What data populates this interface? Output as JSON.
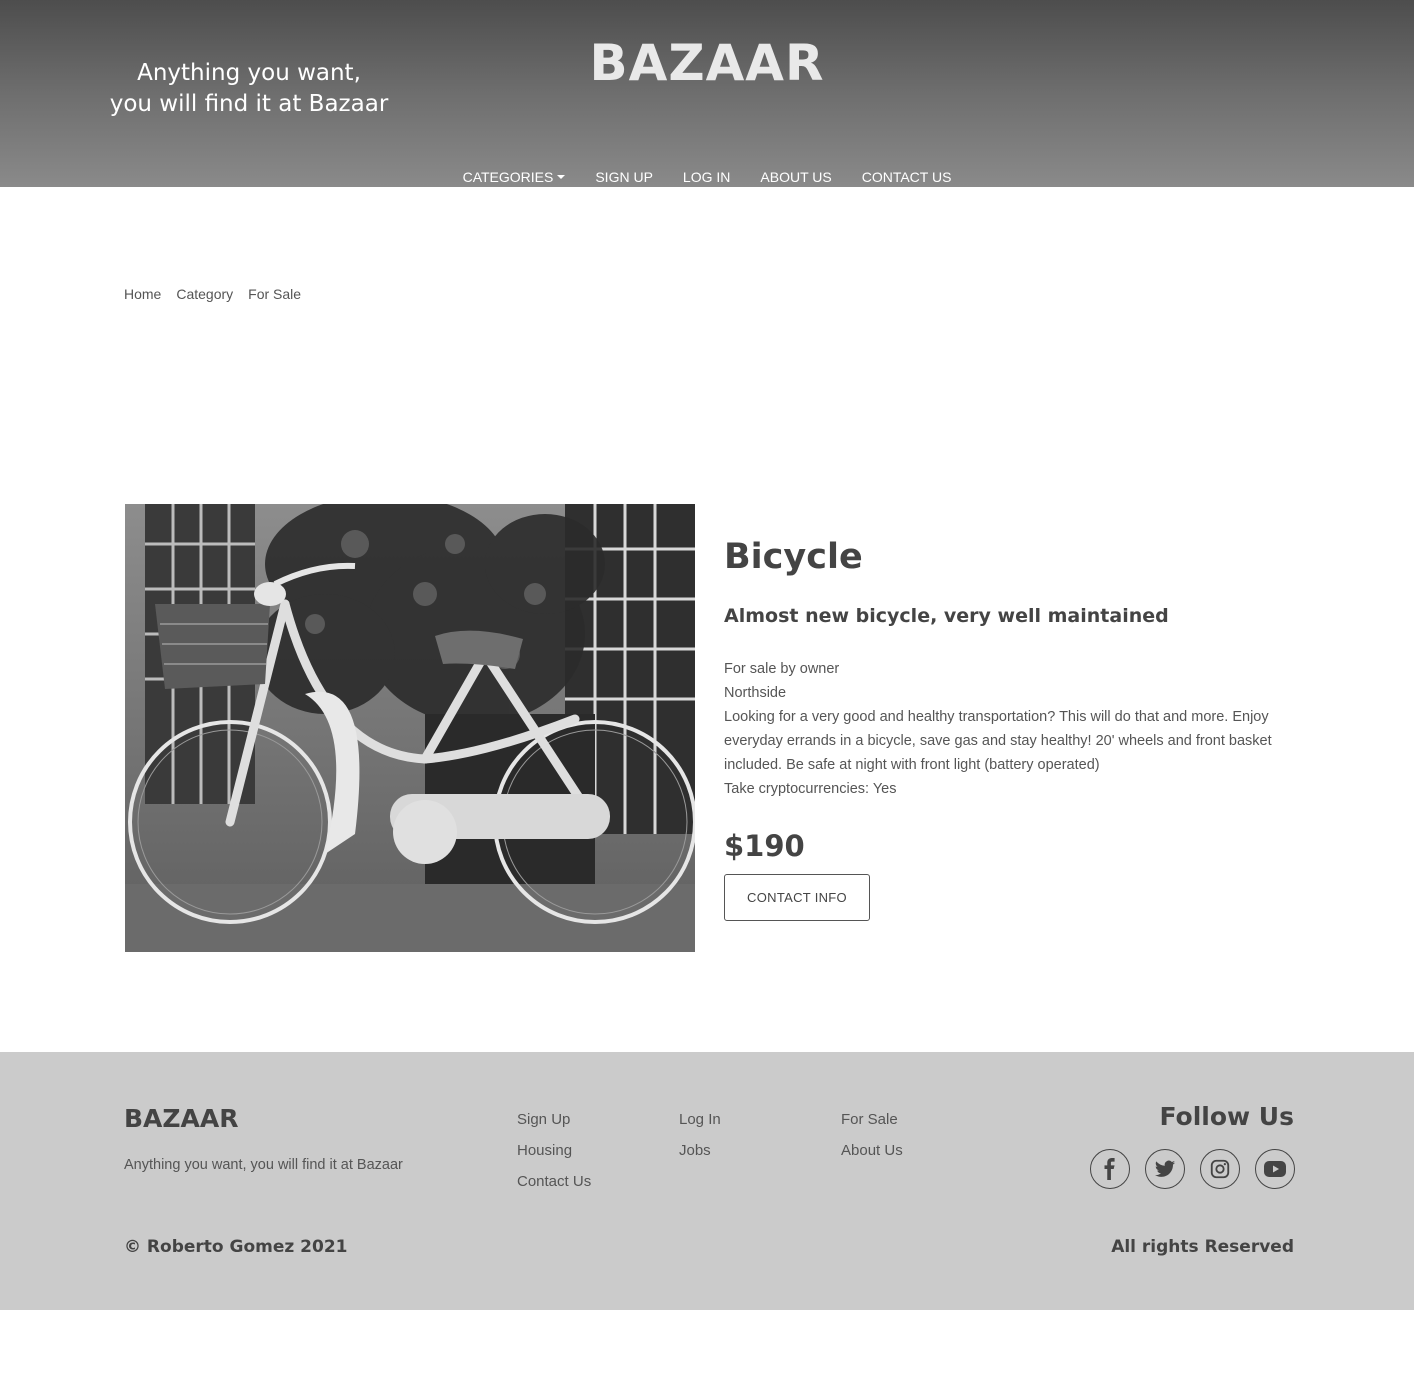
{
  "header": {
    "tagline_line1": "Anything you want,",
    "tagline_line2": "you will find it at Bazaar",
    "brand": "BAZAAR",
    "nav": {
      "categories": "CATEGORIES",
      "signup": "SIGN UP",
      "login": "LOG IN",
      "about": "ABOUT US",
      "contact": "CONTACT US"
    }
  },
  "breadcrumb": {
    "home": "Home",
    "category": "Category",
    "for_sale": "For Sale"
  },
  "product": {
    "title": "Bicycle",
    "subtitle": "Almost new bicycle, very well maintained",
    "seller": "For sale by owner",
    "location": "Northside",
    "description": "Looking for a very good and healthy transportation? This will do that and more. Enjoy everyday errands in a bicycle, save gas and stay healthy! 20' wheels and front basket included. Be safe at night with front light (battery operated)",
    "crypto": "Take cryptocurrencies: Yes",
    "price": "$190",
    "contact_button": "CONTACT INFO",
    "image_icon": "bicycle-photo"
  },
  "footer": {
    "brand": "BAZAAR",
    "tagline": "Anything you want, you will find it at Bazaar",
    "links": {
      "signup": "Sign Up",
      "housing": "Housing",
      "contact": "Contact Us",
      "login": "Log In",
      "jobs": "Jobs",
      "for_sale": "For Sale",
      "about": "About Us"
    },
    "follow": "Follow Us",
    "socials": [
      "facebook-icon",
      "twitter-icon",
      "instagram-icon",
      "youtube-icon"
    ],
    "copyright": "© Roberto Gomez 2021",
    "rights": "All rights Reserved"
  },
  "colors": {
    "header_top": "#4d4d4d",
    "header_bottom": "#8a8a8a",
    "footer_bg": "#cbcbcb",
    "text": "#444444"
  }
}
